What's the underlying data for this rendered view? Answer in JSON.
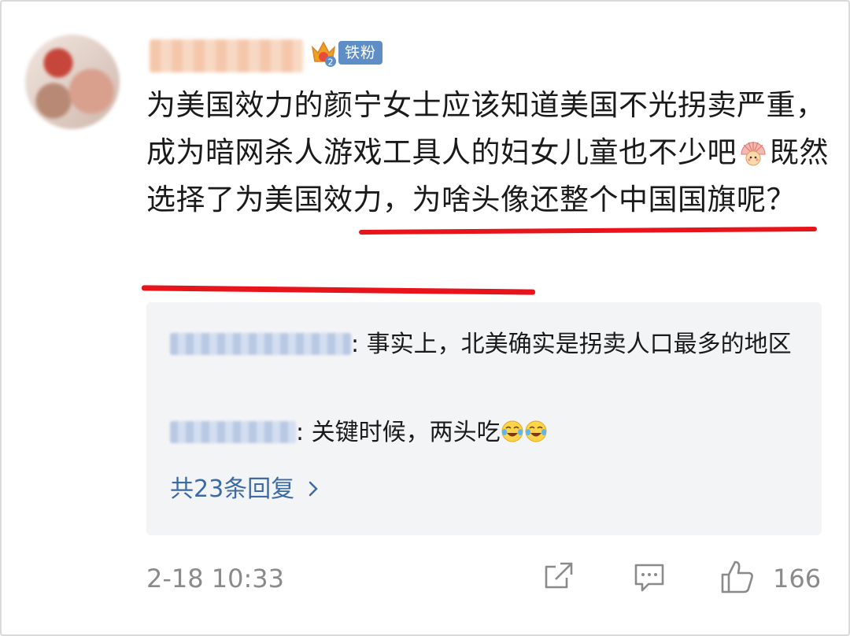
{
  "post": {
    "fan_badge": "铁粉",
    "crown_level": "2",
    "comment_part1": "为美国效力的颜宁女士应该知道美国不光拐卖严重，成为暗网杀人游戏工具人的妇女儿童也不少吧",
    "comment_part2": "既然选择了为美国效力，为啥头像还整个中国国旗呢？",
    "emoji_icon": "fan-face-emoji"
  },
  "replies": [
    {
      "text": ": 事实上，北美确实是拐卖人口最多的地区"
    },
    {
      "text": ": 关键时候，两头吃"
    }
  ],
  "more_replies": "共23条回复 ",
  "footer": {
    "time": "2-18 10:33",
    "like_count": "166"
  },
  "colors": {
    "highlight": "#e8141c",
    "link": "#3d6aa3",
    "badge": "#5f8ec6"
  }
}
